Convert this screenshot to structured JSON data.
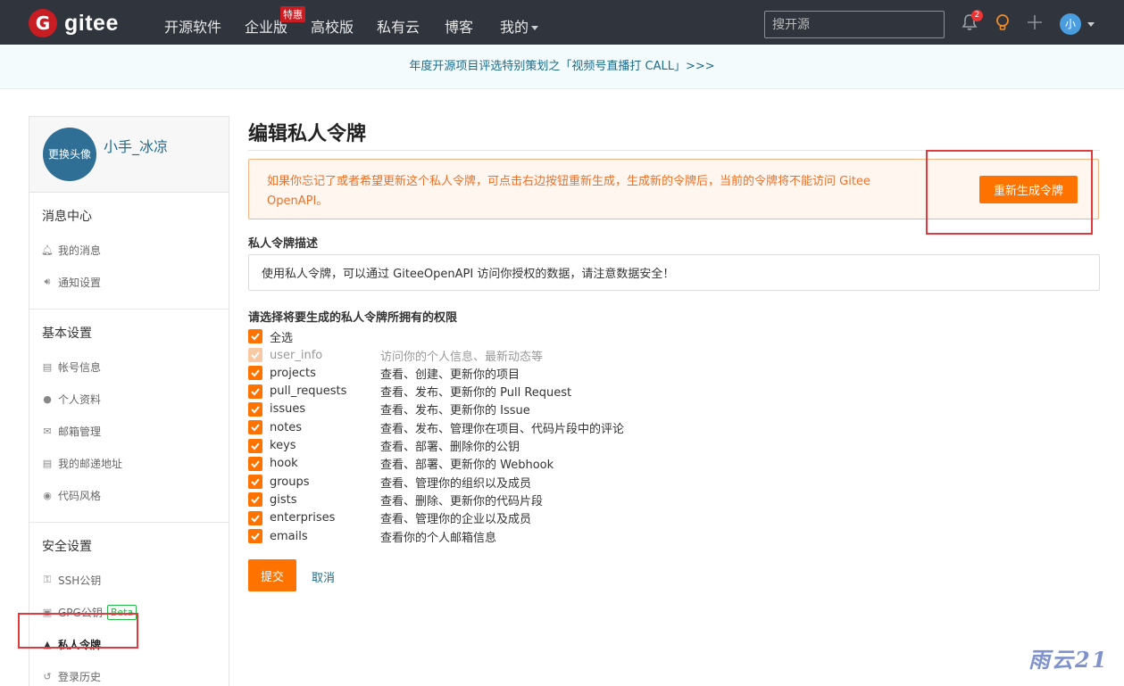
{
  "nav": {
    "logo_mark": "G",
    "logo_text": "gitee",
    "items": [
      "开源软件",
      "企业版",
      "高校版",
      "私有云",
      "博客",
      "我的"
    ],
    "badge": "特惠",
    "search_placeholder": "搜开源",
    "bell_count": "2",
    "avatar": "小"
  },
  "banner": {
    "text": "年度开源项目评选特别策划之「视频号直播打 CALL」>>>"
  },
  "sidebar": {
    "avatar_label": "更换头像",
    "username": "小手_冰凉",
    "sections": [
      {
        "title": "消息中心",
        "items": [
          "我的消息",
          "通知设置"
        ]
      },
      {
        "title": "基本设置",
        "items": [
          "帐号信息",
          "个人资料",
          "邮箱管理",
          "我的邮递地址",
          "代码风格"
        ]
      },
      {
        "title": "安全设置",
        "items": [
          "SSH公钥",
          "GPG公钥",
          "私人令牌",
          "登录历史"
        ]
      }
    ],
    "beta": "Beta"
  },
  "main": {
    "title": "编辑私人令牌",
    "warning": "如果你忘记了或者希望更新这个私人令牌，可点击右边按钮重新生成，生成新的令牌后，当前的令牌将不能访问 Gitee OpenAPI。",
    "regen_button": "重新生成令牌",
    "desc_label": "私人令牌描述",
    "desc_value": "使用私人令牌，可以通过 GiteeOpenAPI 访问你授权的数据，请注意数据安全！",
    "perm_label": "请选择将要生成的私人令牌所拥有的权限",
    "select_all": "全选",
    "permissions": [
      {
        "name": "user_info",
        "desc": "访问你的个人信息、最新动态等",
        "disabled": true
      },
      {
        "name": "projects",
        "desc": "查看、创建、更新你的项目"
      },
      {
        "name": "pull_requests",
        "desc": "查看、发布、更新你的 Pull Request"
      },
      {
        "name": "issues",
        "desc": "查看、发布、更新你的 Issue"
      },
      {
        "name": "notes",
        "desc": "查看、发布、管理你在项目、代码片段中的评论"
      },
      {
        "name": "keys",
        "desc": "查看、部署、删除你的公钥"
      },
      {
        "name": "hook",
        "desc": "查看、部署、更新你的 Webhook"
      },
      {
        "name": "groups",
        "desc": "查看、管理你的组织以及成员"
      },
      {
        "name": "gists",
        "desc": "查看、删除、更新你的代码片段"
      },
      {
        "name": "enterprises",
        "desc": "查看、管理你的企业以及成员"
      },
      {
        "name": "emails",
        "desc": "查看你的个人邮箱信息"
      }
    ],
    "submit": "提交",
    "cancel": "取消"
  },
  "watermark": "雨云21",
  "colors": {
    "accent": "#fe7300",
    "nav_bg": "#2f343d",
    "link": "#1e6b8a",
    "highlight": "#e03a3e"
  }
}
